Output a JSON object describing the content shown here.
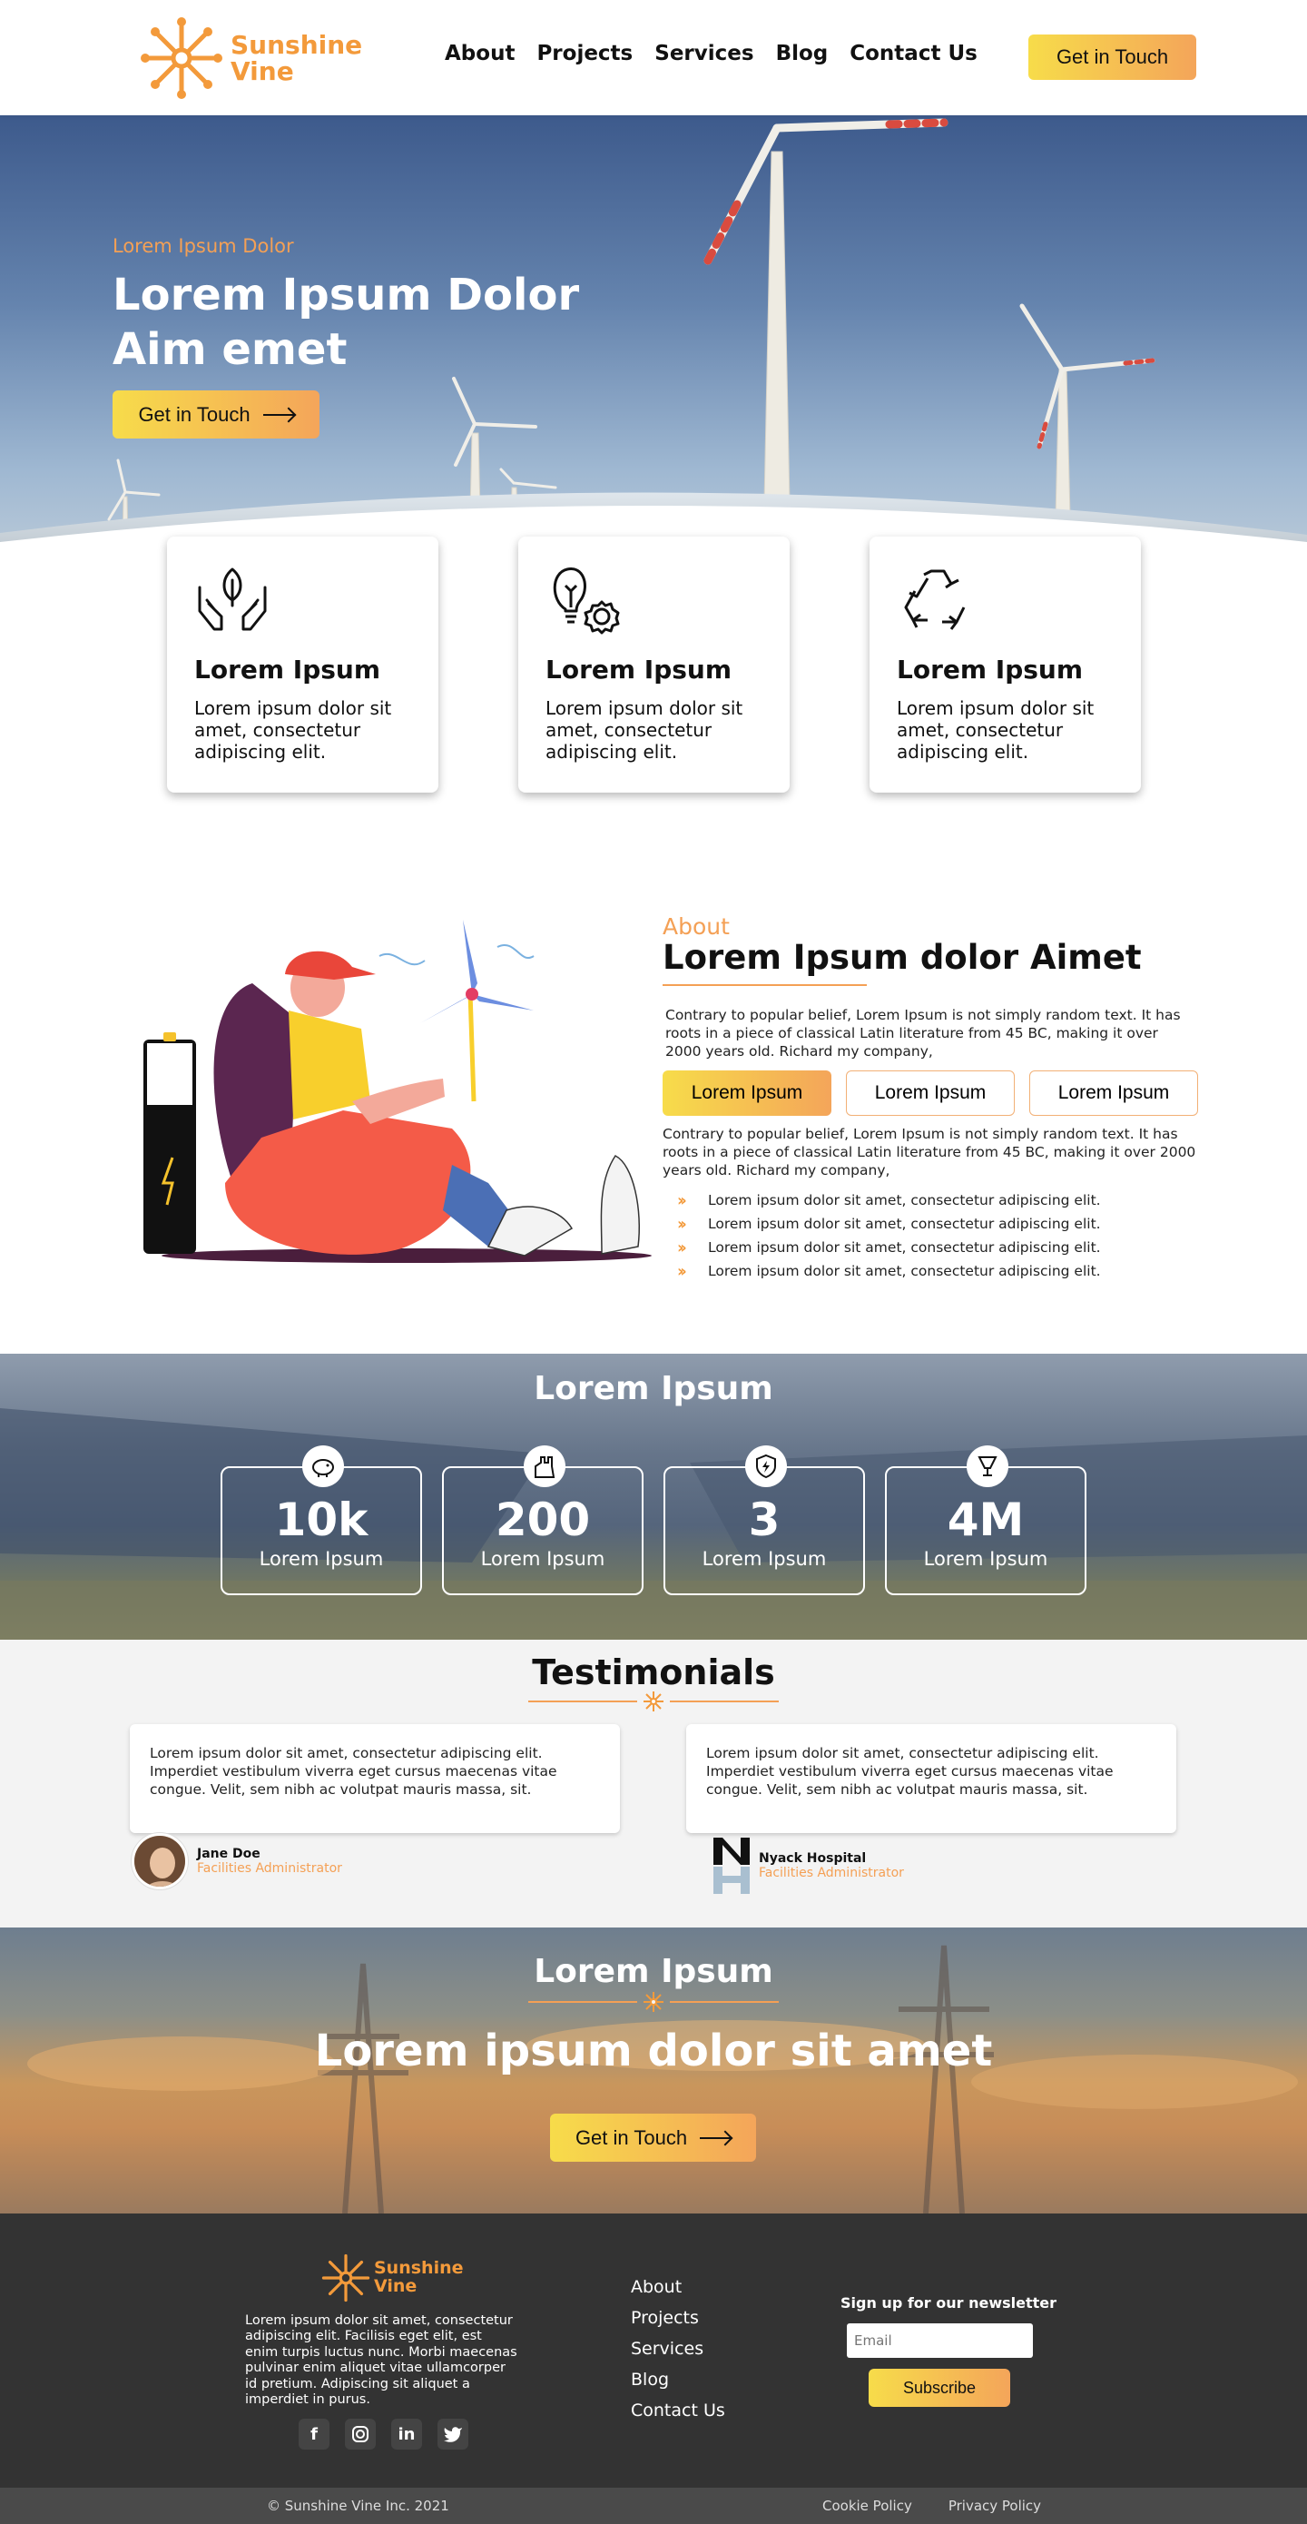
{
  "brand": {
    "name_line1": "Sunshine",
    "name_line2": "Vine",
    "accent": "#f39a3b",
    "gradient_start": "#f7dc4a",
    "gradient_end": "#f4a55a"
  },
  "nav": {
    "links": [
      "About",
      "Projects",
      "Services",
      "Blog",
      "Contact Us"
    ],
    "cta": "Get in Touch"
  },
  "hero": {
    "subtitle": "Lorem Ipsum Dolor",
    "title": "Lorem Ipsum Dolor Aim emet",
    "cta": "Get in Touch"
  },
  "features": [
    {
      "icon": "hands-leaf-icon",
      "title": "Lorem Ipsum",
      "text": "Lorem ipsum dolor sit amet, consectetur adipiscing elit."
    },
    {
      "icon": "bulb-gear-icon",
      "title": "Lorem Ipsum",
      "text": "Lorem ipsum dolor sit amet, consectetur adipiscing elit."
    },
    {
      "icon": "recycle-icon",
      "title": "Lorem Ipsum",
      "text": "Lorem ipsum dolor sit amet, consectetur adipiscing elit."
    }
  ],
  "about": {
    "label": "About",
    "title": "Lorem Ipsum dolor Aimet",
    "paragraph1": "Contrary to popular belief, Lorem Ipsum is not simply random text. It has roots in a piece of classical Latin literature from 45 BC, making it over 2000 years old. Richard my company,",
    "tabs": [
      "Lorem Ipsum",
      "Lorem Ipsum",
      "Lorem Ipsum"
    ],
    "paragraph2": "Contrary to popular belief, Lorem Ipsum is not simply random text. It has roots in a piece of classical Latin literature from 45 BC, making it over 2000 years old. Richard my company,",
    "list": [
      "Lorem ipsum dolor sit amet, consectetur adipiscing elit.",
      "Lorem ipsum dolor sit amet, consectetur adipiscing elit.",
      "Lorem ipsum dolor sit amet, consectetur adipiscing elit.",
      "Lorem ipsum dolor sit amet, consectetur adipiscing elit."
    ]
  },
  "stats": {
    "title": "Lorem Ipsum",
    "items": [
      {
        "icon": "piggy-bank-icon",
        "value": "10k",
        "label": "Lorem Ipsum"
      },
      {
        "icon": "factory-icon",
        "value": "200",
        "label": "Lorem Ipsum"
      },
      {
        "icon": "shield-bolt-icon",
        "value": "3",
        "label": "Lorem Ipsum"
      },
      {
        "icon": "lamp-icon",
        "value": "4M",
        "label": "Lorem Ipsum"
      }
    ]
  },
  "testimonials": {
    "title": "Testimonials",
    "items": [
      {
        "text": "Lorem ipsum dolor sit amet, consectetur adipiscing elit. Imperdiet vestibulum viverra eget cursus maecenas vitae congue. Velit, sem nibh ac volutpat mauris massa, sit.",
        "name": "Jane Doe",
        "role": "Facilities Administrator"
      },
      {
        "text": "Lorem ipsum dolor sit amet, consectetur adipiscing elit. Imperdiet vestibulum viverra eget cursus maecenas vitae congue. Velit, sem nibh ac volutpat mauris massa, sit.",
        "name": "Nyack Hospital",
        "role": "Facilities  Administrator"
      }
    ]
  },
  "cta": {
    "subtitle": "Lorem Ipsum",
    "title": "Lorem ipsum dolor sit amet",
    "button": "Get in Touch"
  },
  "footer": {
    "description": "Lorem ipsum dolor sit amet, consectetur adipiscing elit. Facilisis eget elit, est enim turpis luctus nunc. Morbi maecenas pulvinar enim aliquet vitae ullamcorper id pretium. Adipiscing sit aliquet a imperdiet in purus.",
    "social": [
      "facebook-icon",
      "instagram-icon",
      "linkedin-icon",
      "twitter-icon"
    ],
    "links": [
      "About",
      "Projects",
      "Services",
      "Blog",
      "Contact Us"
    ],
    "newsletter_title": "Sign up for our newsletter",
    "email_placeholder": "Email",
    "subscribe": "Subscribe",
    "copyright": "© Sunshine Vine Inc. 2021",
    "policies": [
      "Cookie Policy",
      "Privacy Policy"
    ]
  }
}
